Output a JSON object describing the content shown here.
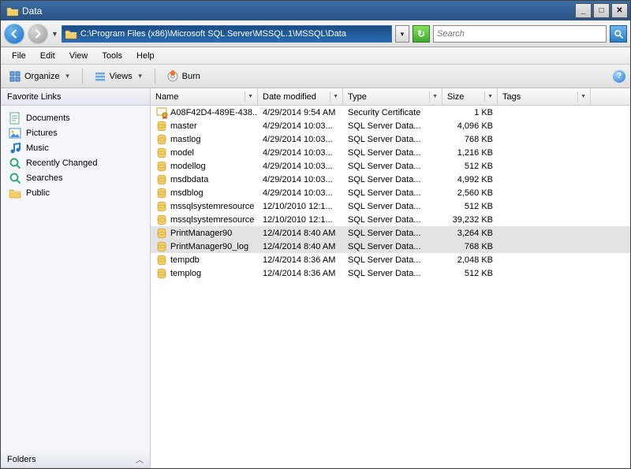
{
  "window": {
    "title": "Data"
  },
  "address": {
    "path": "C:\\Program Files (x86)\\Microsoft SQL Server\\MSSQL.1\\MSSQL\\Data"
  },
  "search": {
    "placeholder": "Search"
  },
  "menu": {
    "file": "File",
    "edit": "Edit",
    "view": "View",
    "tools": "Tools",
    "help": "Help"
  },
  "toolbar": {
    "organize": "Organize",
    "views": "Views",
    "burn": "Burn"
  },
  "sidebar": {
    "favorites_header": "Favorite Links",
    "folders_header": "Folders",
    "items": [
      {
        "label": "Documents",
        "icon": "doc"
      },
      {
        "label": "Pictures",
        "icon": "pic"
      },
      {
        "label": "Music",
        "icon": "music"
      },
      {
        "label": "Recently Changed",
        "icon": "search"
      },
      {
        "label": "Searches",
        "icon": "search"
      },
      {
        "label": "Public",
        "icon": "folder"
      }
    ]
  },
  "columns": {
    "name": "Name",
    "date": "Date modified",
    "type": "Type",
    "size": "Size",
    "tags": "Tags"
  },
  "files": [
    {
      "name": "A08F42D4-489E-438...",
      "date": "4/29/2014 9:54 AM",
      "type": "Security Certificate",
      "size": "1 KB",
      "icon": "cert",
      "sel": false
    },
    {
      "name": "master",
      "date": "4/29/2014 10:03...",
      "type": "SQL Server Data...",
      "size": "4,096 KB",
      "icon": "db",
      "sel": false
    },
    {
      "name": "mastlog",
      "date": "4/29/2014 10:03...",
      "type": "SQL Server Data...",
      "size": "768 KB",
      "icon": "db",
      "sel": false
    },
    {
      "name": "model",
      "date": "4/29/2014 10:03...",
      "type": "SQL Server Data...",
      "size": "1,216 KB",
      "icon": "db",
      "sel": false
    },
    {
      "name": "modellog",
      "date": "4/29/2014 10:03...",
      "type": "SQL Server Data...",
      "size": "512 KB",
      "icon": "db",
      "sel": false
    },
    {
      "name": "msdbdata",
      "date": "4/29/2014 10:03...",
      "type": "SQL Server Data...",
      "size": "4,992 KB",
      "icon": "db",
      "sel": false
    },
    {
      "name": "msdblog",
      "date": "4/29/2014 10:03...",
      "type": "SQL Server Data...",
      "size": "2,560 KB",
      "icon": "db",
      "sel": false
    },
    {
      "name": "mssqlsystemresource",
      "date": "12/10/2010 12:1...",
      "type": "SQL Server Data...",
      "size": "512 KB",
      "icon": "db",
      "sel": false
    },
    {
      "name": "mssqlsystemresource",
      "date": "12/10/2010 12:1...",
      "type": "SQL Server Data...",
      "size": "39,232 KB",
      "icon": "db",
      "sel": false
    },
    {
      "name": "PrintManager90",
      "date": "12/4/2014 8:40 AM",
      "type": "SQL Server Data...",
      "size": "3,264 KB",
      "icon": "db",
      "sel": true
    },
    {
      "name": "PrintManager90_log",
      "date": "12/4/2014 8:40 AM",
      "type": "SQL Server Data...",
      "size": "768 KB",
      "icon": "db",
      "sel": true
    },
    {
      "name": "tempdb",
      "date": "12/4/2014 8:36 AM",
      "type": "SQL Server Data...",
      "size": "2,048 KB",
      "icon": "db",
      "sel": false
    },
    {
      "name": "templog",
      "date": "12/4/2014 8:36 AM",
      "type": "SQL Server Data...",
      "size": "512 KB",
      "icon": "db",
      "sel": false
    }
  ]
}
